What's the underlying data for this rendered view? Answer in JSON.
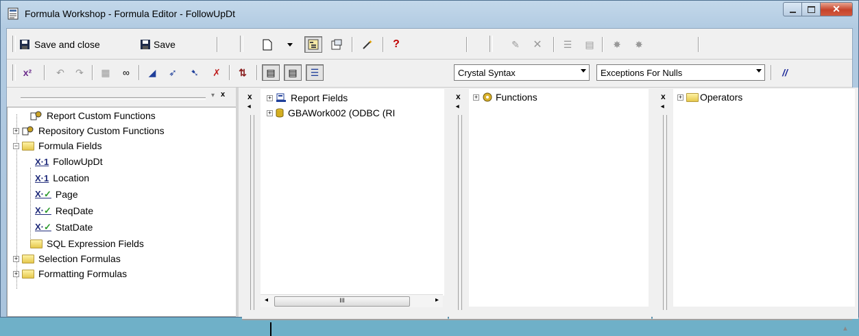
{
  "window": {
    "title": "Formula Workshop - Formula Editor - FollowUpDt"
  },
  "toolbar1": {
    "save_close_label": "Save and close",
    "save_label": "Save"
  },
  "toolbar2": {
    "syntax_select": "Crystal Syntax",
    "nulls_select": "Exceptions For Nulls",
    "comment_label": "//"
  },
  "tree": {
    "items": [
      {
        "label": "Report Custom Functions"
      },
      {
        "label": "Repository Custom Functions"
      },
      {
        "label": "Formula Fields"
      },
      {
        "label": "FollowUpDt"
      },
      {
        "label": "Location"
      },
      {
        "label": "Page"
      },
      {
        "label": "ReqDate"
      },
      {
        "label": "StatDate"
      },
      {
        "label": "SQL Expression Fields"
      },
      {
        "label": "Selection Formulas"
      },
      {
        "label": "Formatting Formulas"
      }
    ]
  },
  "fields_pane": {
    "items": [
      {
        "label": "Report Fields"
      },
      {
        "label": "GBAWork002 (ODBC (RI"
      }
    ],
    "scrollbar_mark": "III"
  },
  "functions_pane": {
    "items": [
      {
        "label": "Functions"
      }
    ]
  },
  "operators_pane": {
    "items": [
      {
        "label": "Operators"
      }
    ]
  }
}
